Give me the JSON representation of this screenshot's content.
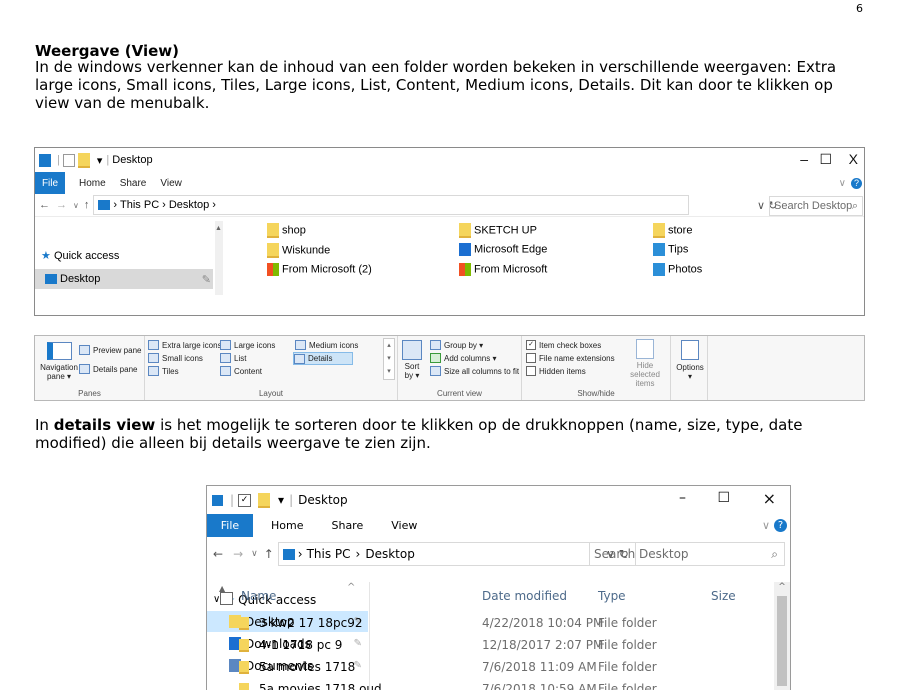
{
  "page_number": "6",
  "heading": "Weergave (View)",
  "intro_text": "In de windows verkenner kan de inhoud van een folder worden bekeken in verschillende weergaven: Extra large icons, Small icons, Tiles, Large icons, List, Content, Medium icons, Details. Dit kan door te klikken op view van de menubalk.",
  "details_text_bold": "details view",
  "details_text_pre": "In ",
  "details_text_post": " is het mogelijk te sorteren door te klikken op de drukknoppen (name, size, type, date modified) die alleen bij details weergave te zien zijn.",
  "explorer1": {
    "title": "Desktop",
    "menu": {
      "file": "File",
      "home": "Home",
      "share": "Share",
      "view": "View"
    },
    "address": {
      "this_pc": "This PC",
      "desktop": "Desktop"
    },
    "search_placeholder": "Search Desktop",
    "nav": {
      "quick_access": "Quick access",
      "desktop": "Desktop"
    },
    "items": [
      {
        "name": "shop",
        "icon": "folder-icon"
      },
      {
        "name": "SKETCH UP",
        "icon": "folder-icon"
      },
      {
        "name": "store",
        "icon": "folder-icon"
      },
      {
        "name": "Wiskunde",
        "icon": "folder-icon"
      },
      {
        "name": "Microsoft Edge",
        "icon": "edge-icon"
      },
      {
        "name": "Tips",
        "icon": "tips-icon"
      },
      {
        "name": "From Microsoft (2)",
        "icon": "microsoft-icon"
      },
      {
        "name": "From Microsoft",
        "icon": "microsoft-icon"
      },
      {
        "name": "Photos",
        "icon": "photos-icon"
      }
    ]
  },
  "ribbon": {
    "panes": {
      "navigation": "Navigation pane ▾",
      "preview": "Preview pane",
      "details": "Details pane",
      "label": "Panes"
    },
    "layout": {
      "extra_large": "Extra large icons",
      "large": "Large icons",
      "medium": "Medium icons",
      "small": "Small icons",
      "list": "List",
      "details": "Details",
      "tiles": "Tiles",
      "content": "Content",
      "label": "Layout"
    },
    "current_view": {
      "sort": "Sort by ▾",
      "group": "Group by ▾",
      "add_columns": "Add columns ▾",
      "size_all": "Size all columns to fit",
      "label": "Current view"
    },
    "show_hide": {
      "checkboxes": "Item check boxes",
      "extensions": "File name extensions",
      "hidden": "Hidden items",
      "hide_selected": "Hide selected items",
      "label": "Show/hide"
    },
    "options": "Options ▾"
  },
  "explorer2": {
    "title": "Desktop",
    "menu": {
      "file": "File",
      "home": "Home",
      "share": "Share",
      "view": "View"
    },
    "address": {
      "this_pc": "This PC",
      "desktop": "Desktop"
    },
    "search_placeholder": "Search Desktop",
    "columns": {
      "name": "Name",
      "date": "Date modified",
      "type": "Type",
      "size": "Size"
    },
    "nav": [
      {
        "label": "Quick access",
        "icon": "star-icon"
      },
      {
        "label": "Desktop",
        "icon": "folder-icon"
      },
      {
        "label": "Downloads",
        "icon": "downloads-icon"
      },
      {
        "label": "Documents",
        "icon": "documents-icon"
      }
    ],
    "rows": [
      {
        "name": "3 kw2 17 18pc92",
        "date": "4/22/2018 10:04 PM",
        "type": "File folder"
      },
      {
        "name": "4-1 1718 pc 9",
        "date": "12/18/2017 2:07 PM",
        "type": "File folder"
      },
      {
        "name": "5a movies 1718",
        "date": "7/6/2018 11:09 AM",
        "type": "File folder"
      },
      {
        "name": "5a movies 1718 oud",
        "date": "7/6/2018 10:59 AM",
        "type": "File folder"
      }
    ]
  },
  "colors": {
    "file_tab": "#1979ca",
    "selected": "#cce8ff",
    "folder": "#f5d55c"
  }
}
